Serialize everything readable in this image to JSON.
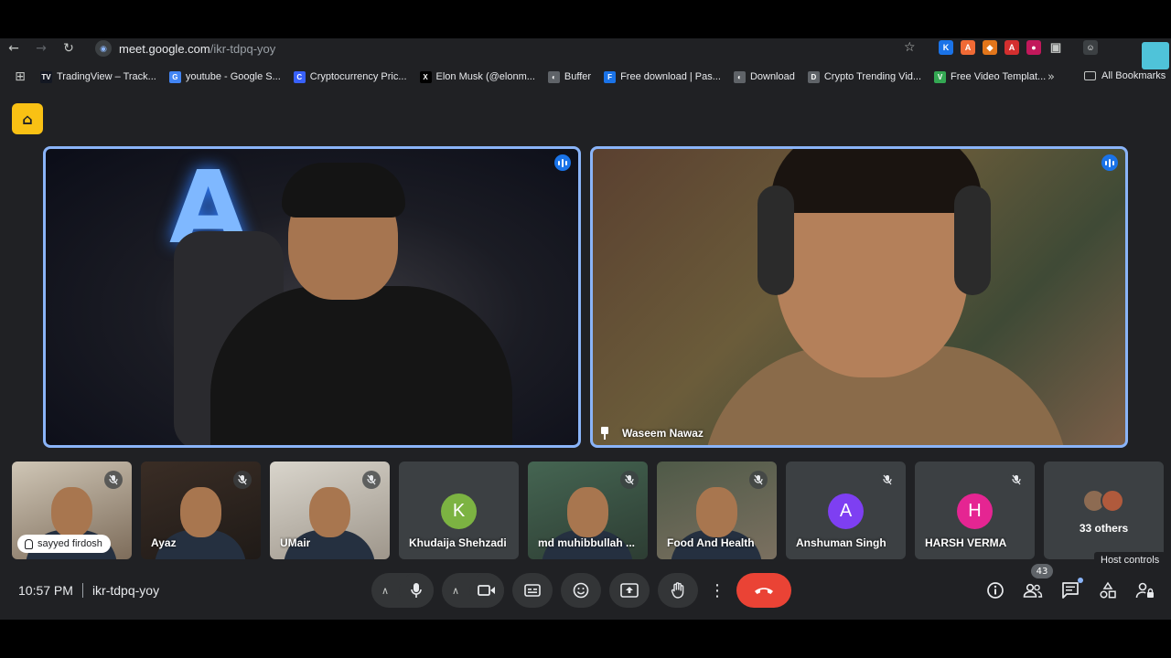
{
  "browser": {
    "url_host": "meet.google.com",
    "url_path": "/ikr-tdpq-yoy",
    "bookmarks": [
      {
        "label": "TradingView – Track...",
        "color": "#131722",
        "glyph": "TV"
      },
      {
        "label": "youtube - Google S...",
        "color": "#4285f4",
        "glyph": "G"
      },
      {
        "label": "Cryptocurrency Pric...",
        "color": "#3861fb",
        "glyph": "C"
      },
      {
        "label": "Elon Musk (@elonm...",
        "color": "#000000",
        "glyph": "X"
      },
      {
        "label": "Buffer",
        "color": "#5f6368",
        "glyph": "◐"
      },
      {
        "label": "Free download | Pas...",
        "color": "#1a73e8",
        "glyph": "F"
      },
      {
        "label": "Download",
        "color": "#5f6368",
        "glyph": "◐"
      },
      {
        "label": "Crypto Trending Vid...",
        "color": "#5f6368",
        "glyph": "D"
      },
      {
        "label": "Free Video Templat...",
        "color": "#34a853",
        "glyph": "V"
      }
    ],
    "all_bookmarks": "All Bookmarks",
    "more": "»"
  },
  "main": {
    "tiles": [
      {
        "name": ""
      },
      {
        "name": "Waseem Nawaz"
      }
    ]
  },
  "participants": [
    {
      "name": "sayyed firdosh",
      "type": "video",
      "style": "video",
      "pill": true,
      "muted": true
    },
    {
      "name": "Ayaz",
      "type": "video",
      "style": "v2",
      "muted": true
    },
    {
      "name": "UMair",
      "type": "video",
      "style": "v3",
      "muted": true
    },
    {
      "name": "Khudaija Shehzadi",
      "type": "avatar",
      "initial": "K",
      "color": "#7cb342",
      "muted": false
    },
    {
      "name": "md muhibbullah ...",
      "type": "video",
      "style": "v5",
      "muted": true
    },
    {
      "name": "Food And Health",
      "type": "video",
      "style": "v6",
      "muted": true
    },
    {
      "name": "Anshuman Singh",
      "type": "avatar",
      "initial": "A",
      "color": "#7e3ff2",
      "muted": true
    },
    {
      "name": "HARSH VERMA",
      "type": "avatar",
      "initial": "H",
      "color": "#e52592",
      "muted": true
    }
  ],
  "others": {
    "label": "33 others"
  },
  "bottom": {
    "time": "10:57 PM",
    "meeting_code": "ikr-tdpq-yoy",
    "people_count": "43",
    "tooltip": "Host controls"
  },
  "icons": {
    "mic": "🎤",
    "cam": "▭",
    "captions": "CC",
    "emoji": "☺",
    "present": "⇧",
    "hand": "✋",
    "more": "⋮",
    "end": "☎",
    "info": "ⓘ",
    "people": "👥",
    "chat": "💬",
    "activities": "△",
    "host": "🔒"
  }
}
